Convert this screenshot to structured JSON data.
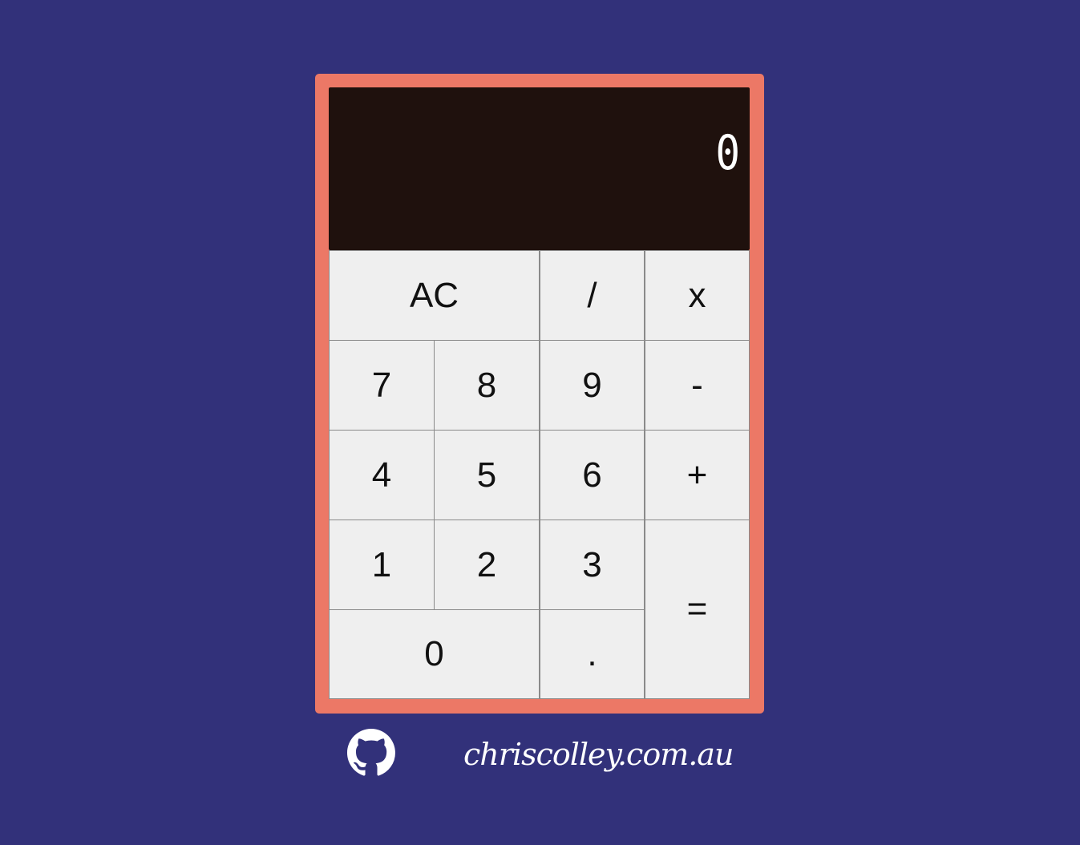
{
  "display": {
    "value": "0"
  },
  "keys": {
    "clear": "AC",
    "divide": "/",
    "multiply": "x",
    "seven": "7",
    "eight": "8",
    "nine": "9",
    "subtract": "-",
    "four": "4",
    "five": "5",
    "six": "6",
    "add": "+",
    "one": "1",
    "two": "2",
    "three": "3",
    "equals": "=",
    "zero": "0",
    "decimal": "."
  },
  "footer": {
    "github_icon": "github-icon",
    "site_link": "chriscolley.com.au"
  },
  "colors": {
    "background": "#32317a",
    "calculator_frame": "#ec7866",
    "display": "#1f110d",
    "key": "#efefef"
  }
}
